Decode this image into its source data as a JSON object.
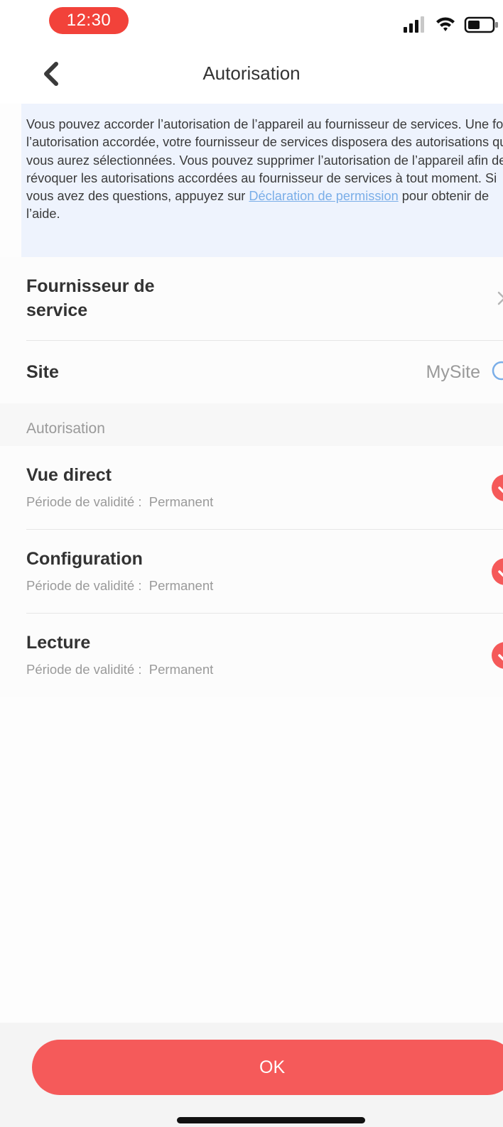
{
  "status_bar": {
    "time": "12:30",
    "icons": [
      "signal-icon",
      "wifi-icon",
      "battery-icon"
    ],
    "time_pill_color": "#f2423a"
  },
  "nav": {
    "title": "Autorisation",
    "back_icon": "chevron-left-icon"
  },
  "info": {
    "text_before_link": "Vous pouvez accorder l’autorisation de l’appareil au fournisseur de services. Une fois l’autorisation accordée, votre fournisseur de services disposera des autorisations que vous aurez sélectionnées. Vous pouvez supprimer l’autorisation de l’appareil afin de révoquer les autorisations accordées au fournisseur de services à tout moment. Si vous avez des questions, appuyez sur ",
    "link_text": "Déclaration de permission",
    "text_after_link": " pour obtenir de l’aide.",
    "link_color": "#7aaee8",
    "background": "#eef3fd"
  },
  "provider": {
    "label": "Fournisseur de service",
    "chevron_icon": "chevron-right-icon"
  },
  "site": {
    "label": "Site",
    "value": "MySite",
    "icon": "info-circle-icon"
  },
  "section": {
    "header": "Autorisation"
  },
  "permissions": [
    {
      "name": "Vue direct",
      "validity_label": "Période de validité :",
      "validity_value": "Permanent",
      "checked": true
    },
    {
      "name": "Configuration",
      "validity_label": "Période de validité :",
      "validity_value": "Permanent",
      "checked": true
    },
    {
      "name": "Lecture",
      "validity_label": "Période de validité :",
      "validity_value": "Permanent",
      "checked": true
    }
  ],
  "check_color": "#f55a5a",
  "ok_button": {
    "label": "OK",
    "color": "#f55a5a"
  }
}
